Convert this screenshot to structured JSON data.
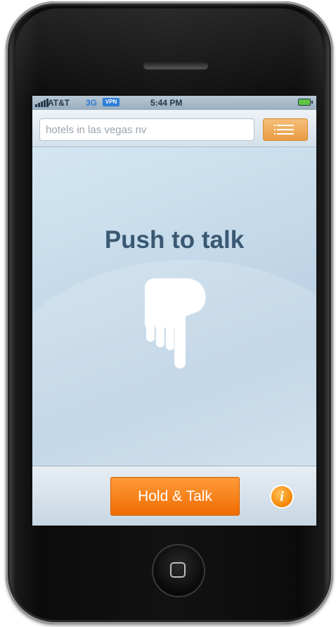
{
  "status_bar": {
    "carrier": "AT&T",
    "network": "3G",
    "vpn": "VPN",
    "time": "5:44 PM",
    "battery_icon": "battery-icon",
    "signal_icon": "signal-bars-icon"
  },
  "search": {
    "value": "hotels in las vegas nv",
    "menu_icon": "list-menu-icon"
  },
  "main": {
    "title": "Push to talk",
    "hand_icon": "pointing-hand-icon"
  },
  "bottom": {
    "hold_talk_label": "Hold & Talk",
    "info_label": "i",
    "info_icon": "info-icon"
  },
  "colors": {
    "accent_orange": "#f47a10",
    "menu_orange": "#eea24b",
    "title_text": "#3a5872",
    "screen_bg": "#c9dbe9"
  }
}
